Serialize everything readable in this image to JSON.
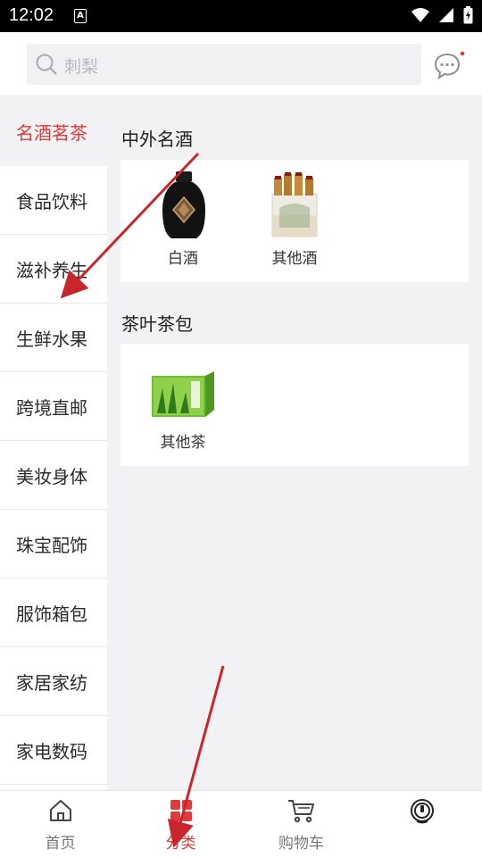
{
  "status": {
    "time": "12:02"
  },
  "search": {
    "placeholder": "刺梨"
  },
  "sidebar": {
    "items": [
      {
        "label": "名酒茗茶",
        "active": true
      },
      {
        "label": "食品饮料"
      },
      {
        "label": "滋补养生"
      },
      {
        "label": "生鲜水果"
      },
      {
        "label": "跨境直邮"
      },
      {
        "label": "美妆身体"
      },
      {
        "label": "珠宝配饰"
      },
      {
        "label": "服饰箱包"
      },
      {
        "label": "家居家纺"
      },
      {
        "label": "家电数码"
      }
    ]
  },
  "sections": [
    {
      "title": "中外名酒",
      "items": [
        {
          "label": "白酒"
        },
        {
          "label": "其他酒"
        }
      ]
    },
    {
      "title": "茶叶茶包",
      "items": [
        {
          "label": "其他茶"
        }
      ]
    }
  ],
  "tabbar": {
    "tabs": [
      {
        "label": "首页"
      },
      {
        "label": "分类",
        "active": true
      },
      {
        "label": "购物车"
      },
      {
        "label": ""
      }
    ]
  },
  "colors": {
    "accent": "#e03a3a",
    "annotation_arrow": "#c8262b"
  }
}
